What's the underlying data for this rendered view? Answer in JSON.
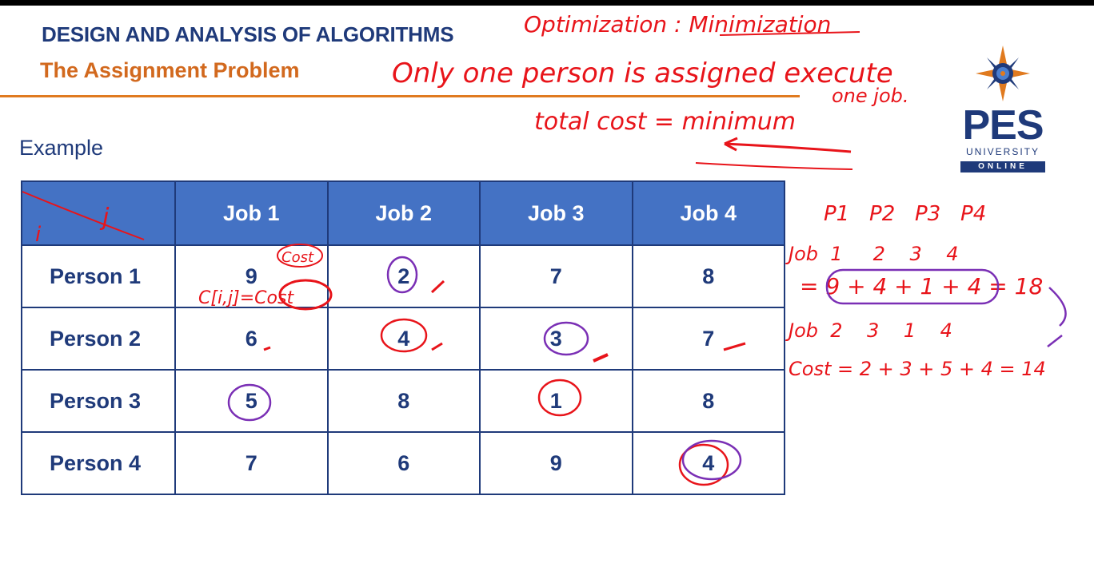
{
  "slide": {
    "course_title": "DESIGN AND ANALYSIS OF ALGORITHMS",
    "topic_title": "The Assignment Problem",
    "section_label": "Example"
  },
  "logo": {
    "name": "PES",
    "line1": "UNIVERSITY",
    "line2": "ONLINE"
  },
  "table": {
    "headers": [
      "",
      "Job 1",
      "Job 2",
      "Job 3",
      "Job 4"
    ],
    "rows": [
      {
        "label": "Person 1",
        "values": [
          "9",
          "2",
          "7",
          "8"
        ]
      },
      {
        "label": "Person 2",
        "values": [
          "6",
          "4",
          "3",
          "7"
        ]
      },
      {
        "label": "Person 3",
        "values": [
          "5",
          "8",
          "1",
          "8"
        ]
      },
      {
        "label": "Person 4",
        "values": [
          "7",
          "6",
          "9",
          "4"
        ]
      }
    ]
  },
  "annotations": {
    "opt": "Optimization : Minimization",
    "rule1": "Only one person is assigned execute",
    "rule1b": "one job.",
    "rule2": "total cost = minimum",
    "corner_j": "j",
    "corner_i": "i",
    "cell_cost": "Cost",
    "cell_formula": "C[i,j]=Cost",
    "p_header": "P1   P2   P3   P4",
    "job_line1": "Job  1     2    3    4",
    "sum_line1": "= 9 + 4 + 1 + 4 = 18",
    "job_line2": "Job  2    3    1    4",
    "sum_line2": "Cost = 2 + 3 + 5 + 4 = 14",
    "colors": {
      "red_ink": "#e8141a",
      "purple_ink": "#7a2fb5",
      "text_blue": "#1f3a7a",
      "header_blue": "#4472c4",
      "accent_orange": "#d2691e"
    }
  }
}
